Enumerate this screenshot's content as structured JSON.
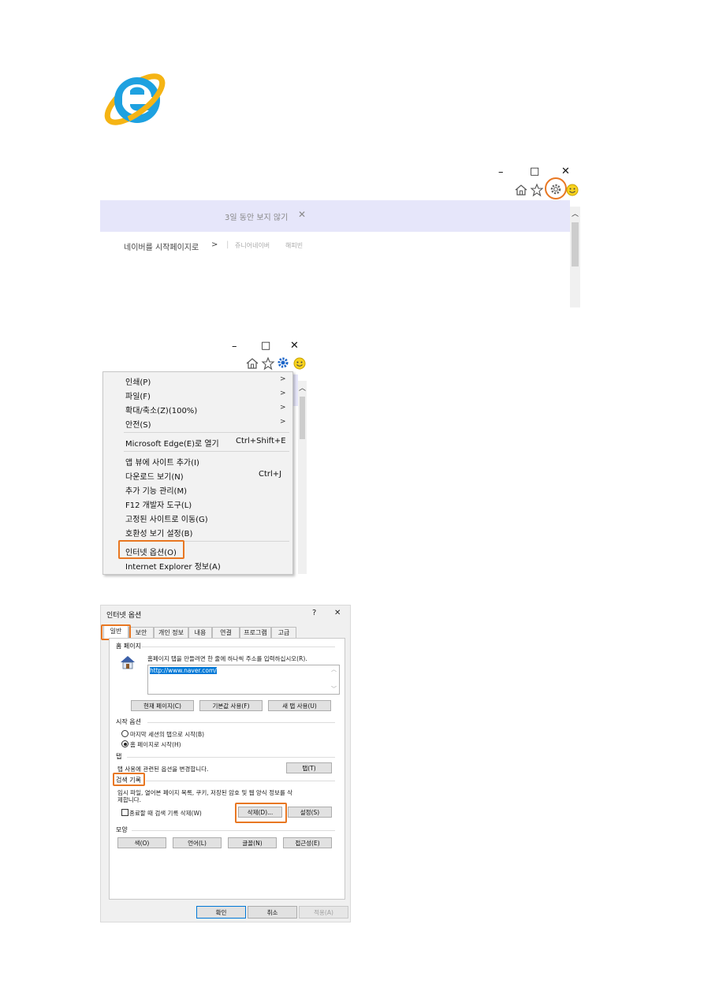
{
  "ie_logo": {
    "icon": "internet-explorer-logo",
    "colors": {
      "blue": "#1ea1e0",
      "ring": "#f5b414"
    }
  },
  "window_controls": {
    "minimize": "–",
    "maximize": "□",
    "close": "✕"
  },
  "browser_top": {
    "infobar": {
      "text": "3일 동안 보지 않기",
      "close": "✕"
    },
    "nav": {
      "start_page": "네이버를 시작페이지로",
      "arrow": ">",
      "sep": "|",
      "junior": "쥬니어네이버",
      "happybean": "해피빈"
    }
  },
  "tools_menu": {
    "items": [
      {
        "label": "인쇄(P)",
        "arrow": ">"
      },
      {
        "label": "파일(F)",
        "arrow": ">"
      },
      {
        "label": "확대/축소(Z)(100%)",
        "arrow": ">"
      },
      {
        "label": "안전(S)",
        "arrow": ">"
      },
      {
        "label": "Microsoft Edge(E)로 열기",
        "shortcut": "Ctrl+Shift+E"
      },
      {
        "label": "앱 뷰에 사이트 추가(I)"
      },
      {
        "label": "다운로드 보기(N)",
        "shortcut": "Ctrl+J"
      },
      {
        "label": "추가 기능 관리(M)"
      },
      {
        "label": "F12 개발자 도구(L)"
      },
      {
        "label": "고정된 사이트로 이동(G)"
      },
      {
        "label": "호환성 보기 설정(B)"
      },
      {
        "label": "인터넷 옵션(O)"
      },
      {
        "label": "Internet Explorer 정보(A)"
      }
    ]
  },
  "internet_options": {
    "title": "인터넷 옵션",
    "help": "?",
    "close": "✕",
    "tabs": [
      "일반",
      "보안",
      "개인 정보",
      "내용",
      "연결",
      "프로그램",
      "고급"
    ],
    "home": {
      "title": "홈 페이지",
      "desc": "홈페이지 탭을 만들려면 한 줄에 하나씩 주소를 입력하십시오(R).",
      "url": "http://www.naver.com/",
      "buttons": [
        "현재 페이지(C)",
        "기본값 사용(F)",
        "새 탭 사용(U)"
      ]
    },
    "startup": {
      "title": "시작 옵션",
      "opt1": "마지막 세션의 탭으로 시작(B)",
      "opt2": "홈 페이지로 시작(H)"
    },
    "tabsec": {
      "title": "탭",
      "desc": "탭 사용에 관련된 옵션을 변경합니다.",
      "button": "탭(T)"
    },
    "history": {
      "title": "검색 기록",
      "desc1": "임시 파일, 열어본 페이지 목록, 쿠키, 저장된 암호 및 웹 양식 정보를 삭",
      "desc2": "제합니다.",
      "checkbox": "종료할 때 검색 기록 삭제(W)",
      "delete": "삭제(D)...",
      "settings": "설정(S)"
    },
    "appearance": {
      "title": "모양",
      "buttons": [
        "색(O)",
        "언어(L)",
        "글꼴(N)",
        "접근성(E)"
      ]
    },
    "footer": {
      "ok": "확인",
      "cancel": "취소",
      "apply": "적용(A)"
    }
  },
  "highlight_color": "#e87722"
}
